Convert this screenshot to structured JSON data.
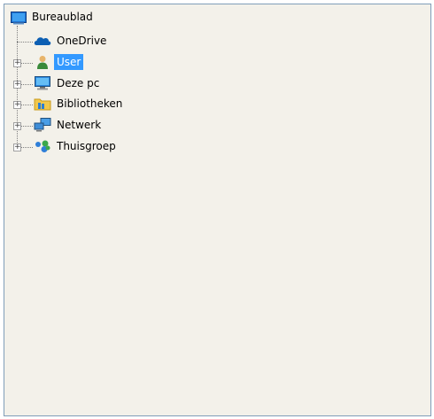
{
  "tree": {
    "root": {
      "label": "Bureaublad",
      "icon": "desktop-icon"
    },
    "items": [
      {
        "label": "OneDrive",
        "icon": "cloud-icon",
        "expandable": false,
        "selected": false
      },
      {
        "label": "User",
        "icon": "user-icon",
        "expandable": true,
        "selected": true
      },
      {
        "label": "Deze pc",
        "icon": "computer-icon",
        "expandable": true,
        "selected": false
      },
      {
        "label": "Bibliotheken",
        "icon": "library-folder-icon",
        "expandable": true,
        "selected": false
      },
      {
        "label": "Netwerk",
        "icon": "network-icon",
        "expandable": true,
        "selected": false
      },
      {
        "label": "Thuisgroep",
        "icon": "homegroup-icon",
        "expandable": true,
        "selected": false
      }
    ],
    "expander_symbol": "+"
  },
  "colors": {
    "panel_bg": "#f3f1ea",
    "border": "#7f9db9",
    "selection": "#3399ff"
  }
}
